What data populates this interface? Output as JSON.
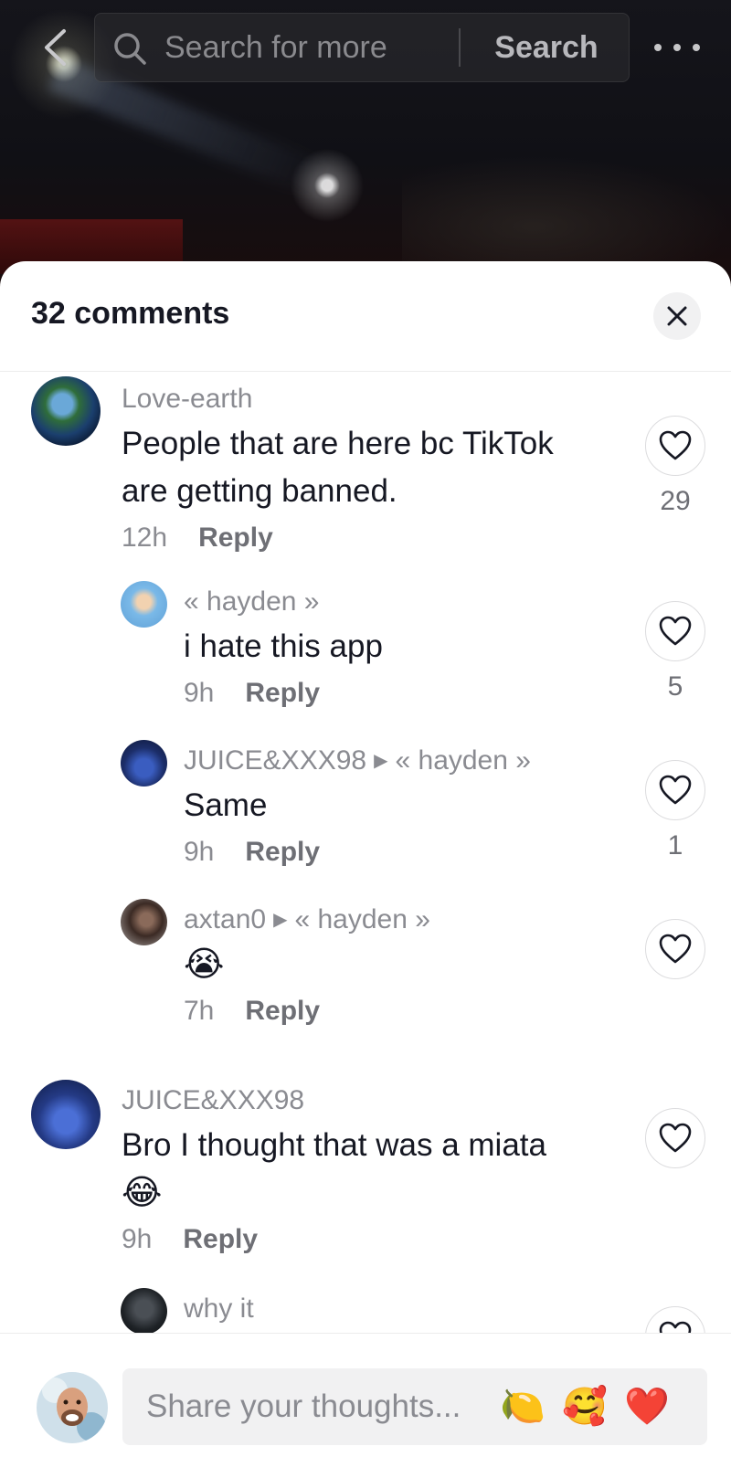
{
  "search": {
    "placeholder": "Search for more",
    "button_label": "Search"
  },
  "sheet": {
    "title": "32 comments"
  },
  "comments": [
    {
      "username": "Love-earth",
      "reply_to": "",
      "text": "People that are here bc TikTok are getting banned.",
      "time": "12h",
      "reply_label": "Reply",
      "likes": "29"
    },
    {
      "username": "« hayden »",
      "reply_to": "",
      "text": "i hate this app",
      "time": "9h",
      "reply_label": "Reply",
      "likes": "5"
    },
    {
      "username": "JUICE&XXX98",
      "reply_to": "« hayden »",
      "text": "Same",
      "time": "9h",
      "reply_label": "Reply",
      "likes": "1"
    },
    {
      "username": "axtan0",
      "reply_to": "« hayden »",
      "text": "😭",
      "time": "7h",
      "reply_label": "Reply",
      "likes": ""
    },
    {
      "username": "JUICE&XXX98",
      "reply_to": "",
      "text": "Bro I thought that was a miata",
      "text_emoji": "😂",
      "time": "9h",
      "reply_label": "Reply",
      "likes": ""
    },
    {
      "username": "why it",
      "reply_to": "",
      "text": "",
      "time": "",
      "reply_label": "",
      "likes": ""
    }
  ],
  "composer": {
    "placeholder": "Share your thoughts...",
    "quick_emojis": [
      "🍋",
      "🥰",
      "❤️"
    ]
  },
  "icons": {
    "back": "chevron-left-icon",
    "search": "search-icon",
    "more": "more-horizontal-icon",
    "close": "close-icon",
    "like": "heart-outline-icon"
  }
}
